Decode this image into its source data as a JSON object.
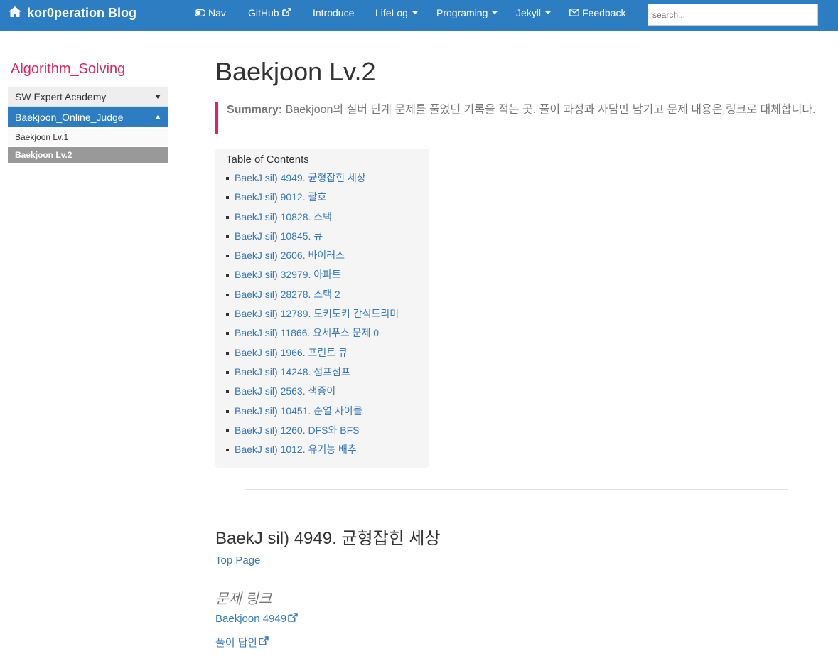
{
  "navbar": {
    "brand": "kor0peration Blog",
    "items": [
      {
        "label": "Nav",
        "icon": "toggle-icon"
      },
      {
        "label": "GitHub",
        "icon": "external-link-icon"
      },
      {
        "label": "Introduce"
      },
      {
        "label": "LifeLog",
        "dropdown": true
      },
      {
        "label": "Programing",
        "dropdown": true
      },
      {
        "label": "Jekyll",
        "dropdown": true
      },
      {
        "label": "Feedback",
        "icon": "envelope-icon"
      }
    ],
    "search_placeholder": "search..."
  },
  "sidebar": {
    "title": "Algorithm_Solving",
    "groups": [
      {
        "label": "SW Expert Academy",
        "expanded": false
      },
      {
        "label": "Baekjoon_Online_Judge",
        "expanded": true
      }
    ],
    "items": [
      {
        "label": "Baekjoon Lv.1",
        "active": false
      },
      {
        "label": "Baekjoon Lv.2",
        "active": true
      }
    ]
  },
  "main": {
    "title": "Baekjoon Lv.2",
    "summary_label": "Summary:",
    "summary_text": " Baekjoon의 실버 단계 문제를 풀었던 기록을 적는 곳. 풀이 과정과 사담만 남기고 문제 내용은 링크로 대체합니다.",
    "toc": {
      "title": "Table of Contents",
      "items": [
        "BaekJ sil) 4949. 균형잡힌 세상",
        "BaekJ sil) 9012. 괄호",
        "BaekJ sil) 10828. 스택",
        "BaekJ sil) 10845. 큐",
        "BaekJ sil) 2606. 바이러스",
        "BaekJ sil) 32979. 아파트",
        "BaekJ sil) 28278. 스택 2",
        "BaekJ sil) 12789. 도키도키 간식드리미",
        "BaekJ sil) 11866. 요세푸스 문제 0",
        "BaekJ sil) 1966. 프린트 큐",
        "BaekJ sil) 14248. 점프점프",
        "BaekJ sil) 2563. 색종이",
        "BaekJ sil) 10451. 순열 사이클",
        "BaekJ sil) 1260. DFS와 BFS",
        "BaekJ sil) 1012. 유기농 배추"
      ]
    },
    "section": {
      "title": "BaekJ sil) 4949. 균형잡힌 세상",
      "top_page": "Top Page",
      "problem_heading": "문제 링크",
      "problem_link": "Baekjoon 4949",
      "answer_link": "풀이 답안"
    }
  },
  "colors": {
    "navbar": "#2c7dc2",
    "accent": "#e0245e",
    "link": "#337ab7",
    "active_item": "#999999"
  }
}
